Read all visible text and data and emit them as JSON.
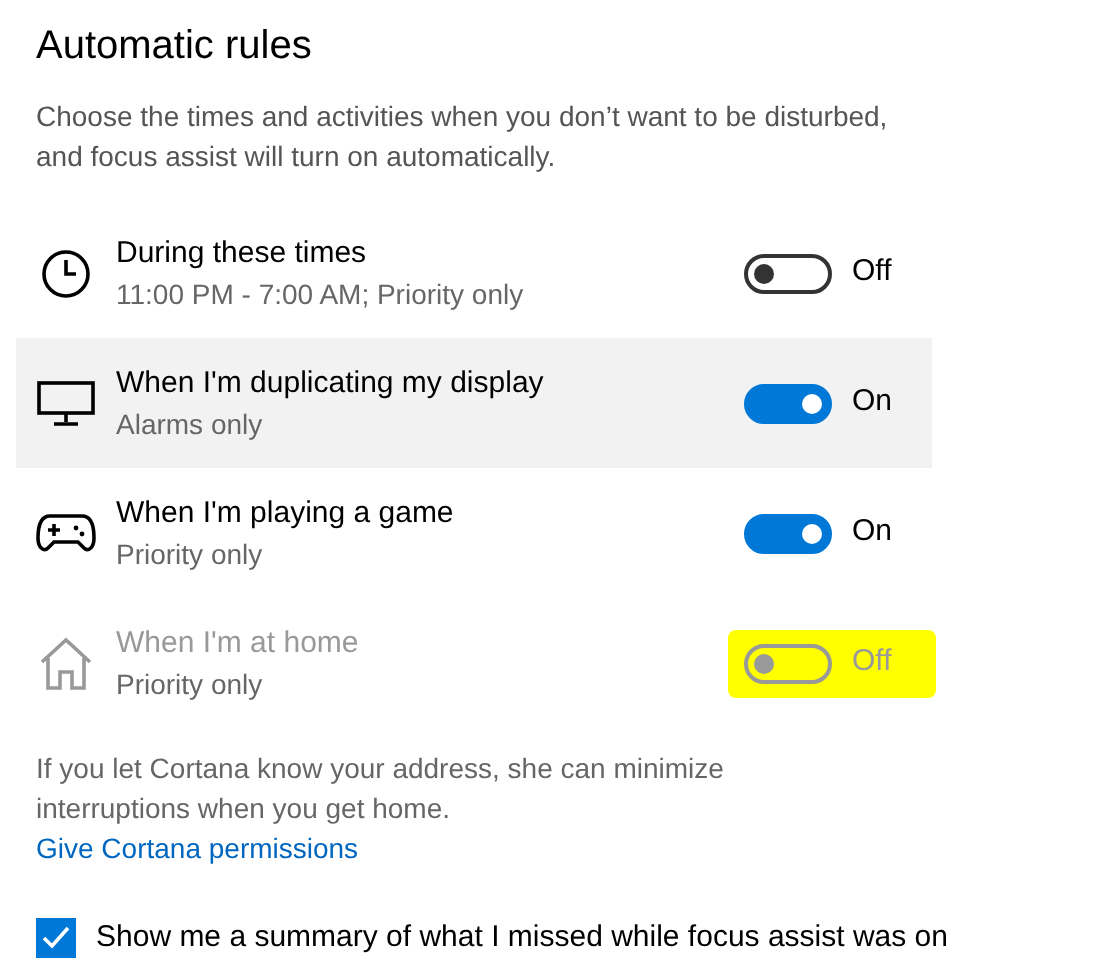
{
  "heading": "Automatic rules",
  "description": "Choose the times and activities when you don’t want to be disturbed, and focus assist will turn on automatically.",
  "rules": [
    {
      "title": "During these times",
      "subtitle": "11:00 PM - 7:00 AM; Priority only",
      "on": false,
      "state_label": "Off",
      "disabled": false,
      "hovered": false,
      "highlighted": false
    },
    {
      "title": "When I'm duplicating my display",
      "subtitle": "Alarms only",
      "on": true,
      "state_label": "On",
      "disabled": false,
      "hovered": true,
      "highlighted": false
    },
    {
      "title": "When I'm playing a game",
      "subtitle": "Priority only",
      "on": true,
      "state_label": "On",
      "disabled": false,
      "hovered": false,
      "highlighted": false
    },
    {
      "title": "When I'm at home",
      "subtitle": "Priority only",
      "on": false,
      "state_label": "Off",
      "disabled": true,
      "hovered": false,
      "highlighted": true
    }
  ],
  "note": "If you let Cortana know your address, she can minimize interruptions when you get home.",
  "link": "Give Cortana permissions",
  "summary_checkbox": {
    "label": "Show me a summary of what I missed while focus assist was on",
    "checked": true
  }
}
